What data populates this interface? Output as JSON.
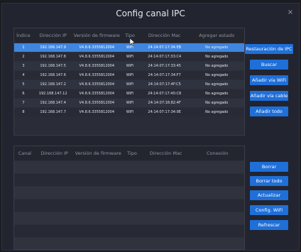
{
  "window": {
    "title": "Config canal IPC",
    "close_glyph": "×"
  },
  "top_table": {
    "headers": [
      "Índice",
      "Dirección IP",
      "Versión de firmware",
      "Tipo",
      "Dirección Mac",
      "Agregar estado"
    ],
    "rows": [
      [
        "1",
        "192.168.147.9",
        "V4.8.6.3355812004",
        "WiFi",
        "24:14:07:17:34:EB",
        "No agregado"
      ],
      [
        "2",
        "192.168.147.8",
        "V4.8.6.3355812004",
        "WiFi",
        "24:14:07:17:33:C4",
        "No agregado"
      ],
      [
        "3",
        "192.168.147.5",
        "V4.8.6.3355812004",
        "WiFi",
        "24:14:07:17:33:45",
        "No agregado"
      ],
      [
        "4",
        "192.168.147.6",
        "V4.8.6.3355812004",
        "WiFi",
        "24:14:07:17:34:F7",
        "No agregado"
      ],
      [
        "5",
        "192.168.147.2",
        "V4.8.6.3355812004",
        "WiFi",
        "24:14:07:17:4F:C5",
        "No agregado"
      ],
      [
        "6",
        "192.168.147.12",
        "V4.8.6.3355812004",
        "WiFi",
        "24:14:07:17:40:C8",
        "No agregado"
      ],
      [
        "7",
        "192.168.147.4",
        "V4.8.6.3355812004",
        "WiFi",
        "24:14:07:16:82:4F",
        "No agregado"
      ],
      [
        "8",
        "192.168.147.7",
        "V4.8.6.3355812004",
        "WiFi",
        "24:14:07:17:34:9E",
        "No agregado"
      ]
    ],
    "selected_row": 0
  },
  "bottom_table": {
    "headers": [
      "Canal",
      "Dirección IP",
      "Versión de firmware",
      "Tipo",
      "Dirección Mac",
      "Conexión"
    ]
  },
  "buttons_top": {
    "restore": "Restauración de IPC",
    "search": "Buscar",
    "add_wifi": "Añadir vía WiFi",
    "add_cable": "Añadir vía cable",
    "add_all": "Añadir todo"
  },
  "buttons_bottom": {
    "delete": "Borrar",
    "delete_all": "Borrar todo",
    "update": "Actualizar",
    "wifi_config": "Config. WiFi",
    "refresh": "Refrescar"
  },
  "colors": {
    "accent": "#1f6fd8",
    "selected_row": "#3f86e0",
    "background": "#222430"
  },
  "icons": {
    "close": "close-icon",
    "cursor": "mouse-cursor-icon"
  }
}
